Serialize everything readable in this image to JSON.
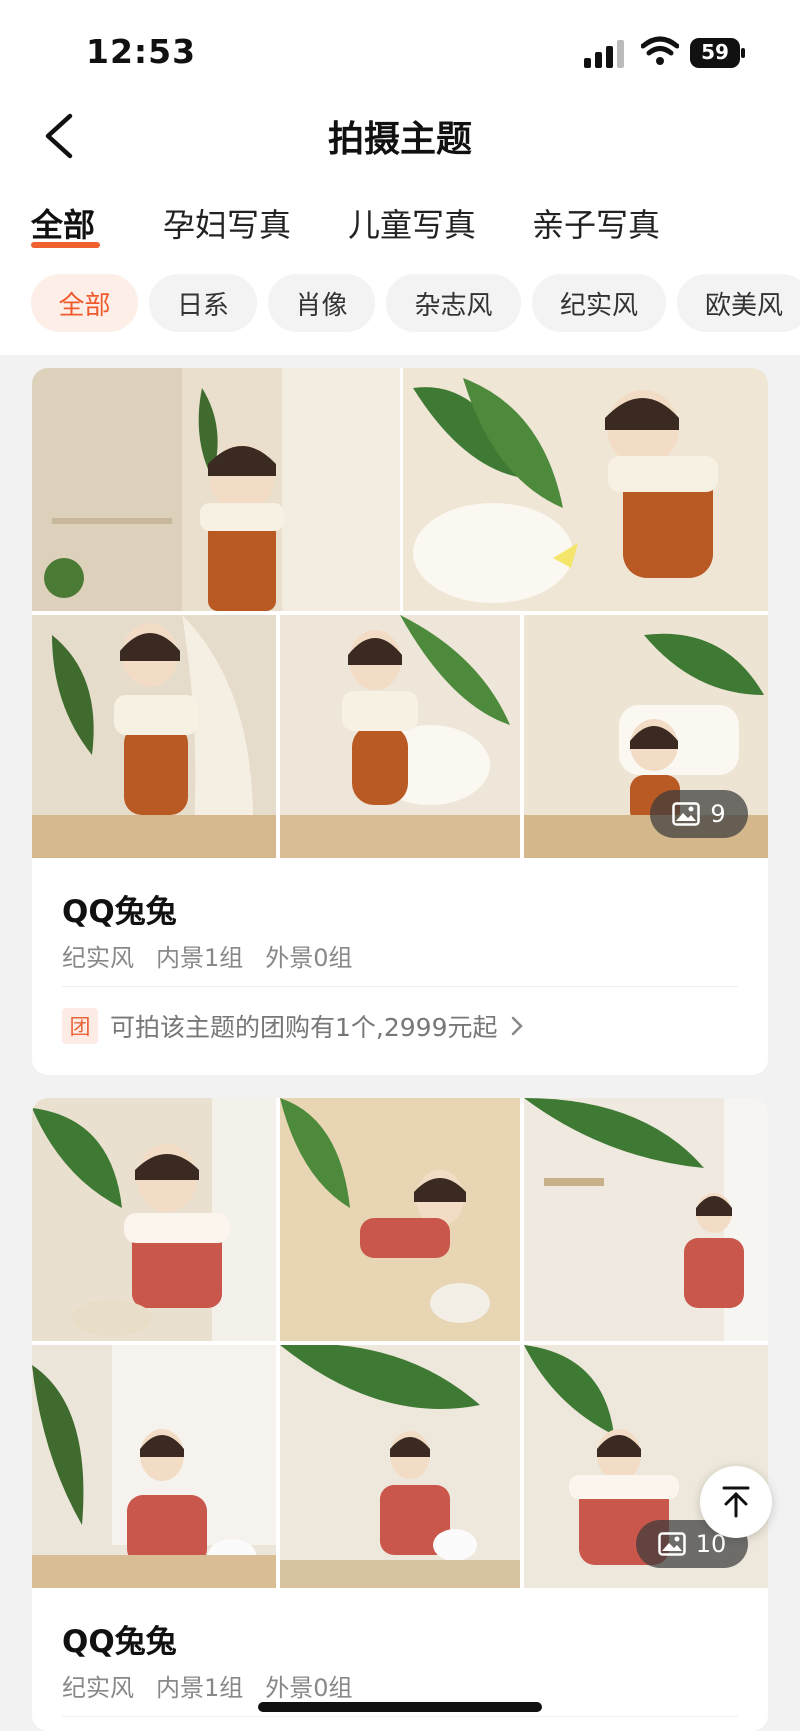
{
  "status_bar": {
    "time": "12:53",
    "battery": "59"
  },
  "nav": {
    "title": "拍摄主题",
    "back_icon": "chevron-left-icon"
  },
  "tabs": [
    {
      "label": "全部",
      "active": true
    },
    {
      "label": "孕妇写真",
      "active": false
    },
    {
      "label": "儿童写真",
      "active": false
    },
    {
      "label": "亲子写真",
      "active": false
    }
  ],
  "filters": [
    {
      "label": "全部",
      "active": true
    },
    {
      "label": "日系",
      "active": false
    },
    {
      "label": "肖像",
      "active": false
    },
    {
      "label": "杂志风",
      "active": false
    },
    {
      "label": "纪实风",
      "active": false
    },
    {
      "label": "欧美风",
      "active": false
    }
  ],
  "cards": [
    {
      "title": "QQ兔兔",
      "style": "纪实风",
      "indoor": "内景1组",
      "outdoor": "外景0组",
      "photo_count": "9",
      "promo_tag": "团",
      "promo_text": "可拍该主题的团购有1个,2999元起"
    },
    {
      "title": "QQ兔兔",
      "style": "纪实风",
      "indoor": "内景1组",
      "outdoor": "外景0组",
      "photo_count": "10"
    }
  ],
  "colors": {
    "accent": "#f0612f",
    "chip_active_bg": "#fdeee8",
    "card_bg": "#ffffff",
    "page_bg": "#f2f2f2"
  },
  "watermark": "GPM",
  "icons": {
    "image": "image-icon",
    "back_to_top": "arrow-up-icon",
    "chevron": "chevron-right-icon"
  }
}
